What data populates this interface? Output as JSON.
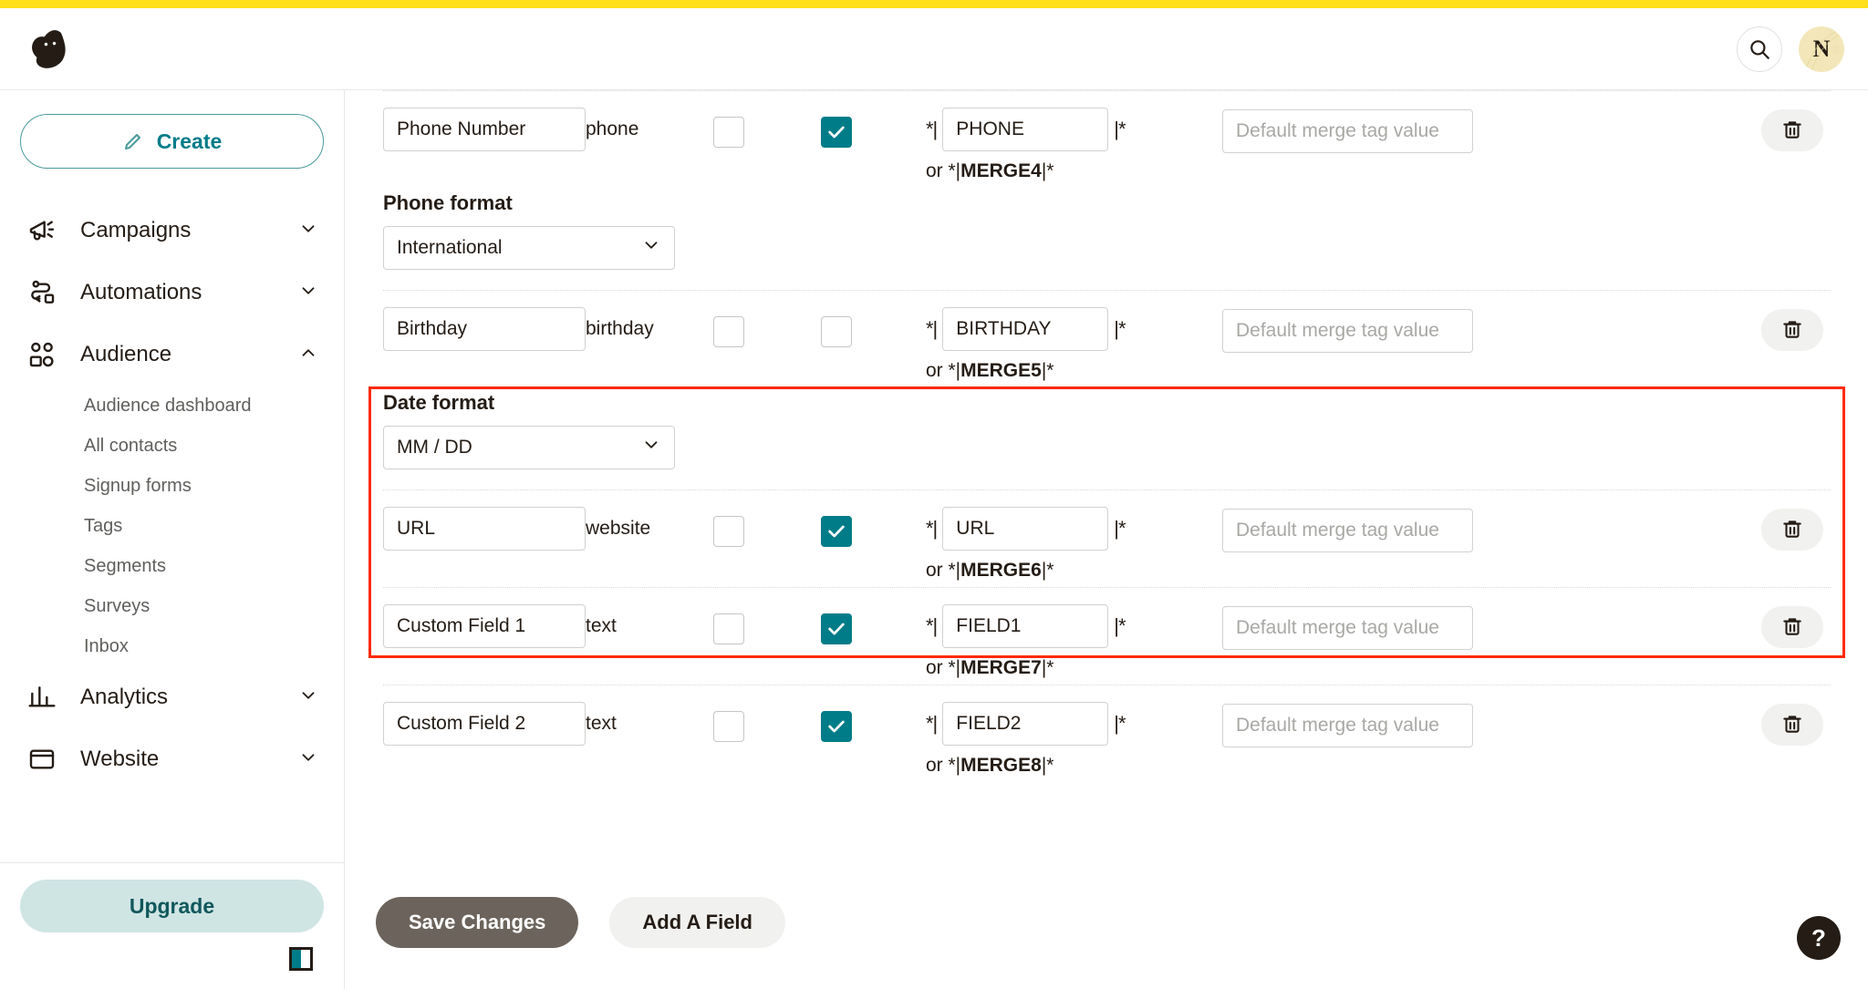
{
  "header": {
    "logo_alt": "Mailchimp",
    "search_icon": "search-icon",
    "avatar_initial": "N"
  },
  "sidebar": {
    "create_label": "Create",
    "groups": [
      {
        "icon": "megaphone-icon",
        "label": "Campaigns",
        "chevron": "chevron-down-icon",
        "expanded": false,
        "children": []
      },
      {
        "icon": "automations-icon",
        "label": "Automations",
        "chevron": "chevron-down-icon",
        "expanded": false,
        "children": []
      },
      {
        "icon": "audience-icon",
        "label": "Audience",
        "chevron": "chevron-up-icon",
        "expanded": true,
        "children": [
          "Audience dashboard",
          "All contacts",
          "Signup forms",
          "Tags",
          "Segments",
          "Surveys",
          "Inbox"
        ]
      },
      {
        "icon": "analytics-icon",
        "label": "Analytics",
        "chevron": "chevron-down-icon",
        "expanded": false,
        "children": []
      },
      {
        "icon": "website-icon",
        "label": "Website",
        "chevron": "chevron-down-icon",
        "expanded": false,
        "children": []
      }
    ],
    "upgrade_label": "Upgrade",
    "collapse_icon": "panel-collapse-icon"
  },
  "main": {
    "default_placeholder": "Default merge tag value",
    "rows": [
      {
        "name": "Phone Number",
        "type": "phone",
        "required": false,
        "visible": true,
        "merge_tag": "PHONE",
        "merge_alt_prefix": "or *|",
        "merge_alt_code": "MERGE4",
        "merge_alt_suffix": "|*",
        "default_value": "",
        "delete_icon": "trash-icon",
        "highlighted": false,
        "sub": {
          "label": "Phone format",
          "value": "International",
          "chevron": "chevron-down-icon"
        }
      },
      {
        "name": "Birthday",
        "type": "birthday",
        "required": false,
        "visible": false,
        "merge_tag": "BIRTHDAY",
        "merge_alt_prefix": "or *|",
        "merge_alt_code": "MERGE5",
        "merge_alt_suffix": "|*",
        "default_value": "",
        "delete_icon": "trash-icon",
        "highlighted": false,
        "sub": {
          "label": "Date format",
          "value": "MM / DD",
          "chevron": "chevron-down-icon"
        }
      },
      {
        "name": "URL",
        "type": "website",
        "required": false,
        "visible": true,
        "merge_tag": "URL",
        "merge_alt_prefix": "or *|",
        "merge_alt_code": "MERGE6",
        "merge_alt_suffix": "|*",
        "default_value": "",
        "delete_icon": "trash-icon",
        "highlighted": true,
        "sub": null
      },
      {
        "name": "Custom Field 1",
        "type": "text",
        "required": false,
        "visible": true,
        "merge_tag": "FIELD1",
        "merge_alt_prefix": "or *|",
        "merge_alt_code": "MERGE7",
        "merge_alt_suffix": "|*",
        "default_value": "",
        "delete_icon": "trash-icon",
        "highlighted": true,
        "sub": null
      },
      {
        "name": "Custom Field 2",
        "type": "text",
        "required": false,
        "visible": true,
        "merge_tag": "FIELD2",
        "merge_alt_prefix": "or *|",
        "merge_alt_code": "MERGE8",
        "merge_alt_suffix": "|*",
        "default_value": "",
        "delete_icon": "trash-icon",
        "highlighted": true,
        "sub": null
      }
    ],
    "save_label": "Save Changes",
    "add_field_label": "Add A Field",
    "help_label": "?"
  },
  "colors": {
    "brand_yellow": "#FFE01B",
    "teal": "#007c89",
    "highlight_red": "#ff2a00",
    "save_button": "#6c645c"
  }
}
